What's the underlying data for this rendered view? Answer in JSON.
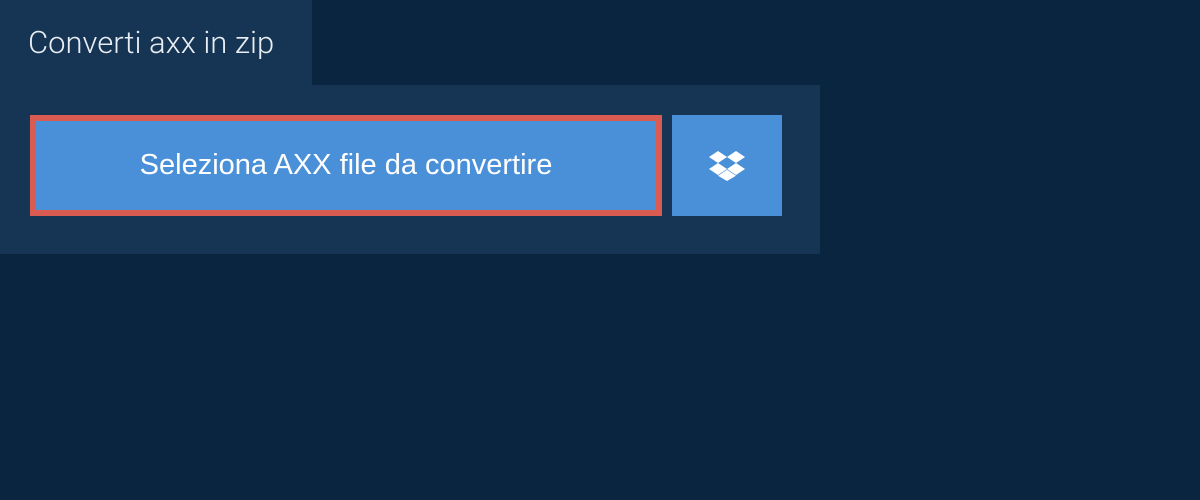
{
  "tab": {
    "title": "Converti axx in zip"
  },
  "main": {
    "select_button_label": "Seleziona AXX file da convertire"
  },
  "colors": {
    "background": "#0a2540",
    "panel": "#163453",
    "button": "#4a90d9",
    "highlight_border": "#d95b52"
  }
}
